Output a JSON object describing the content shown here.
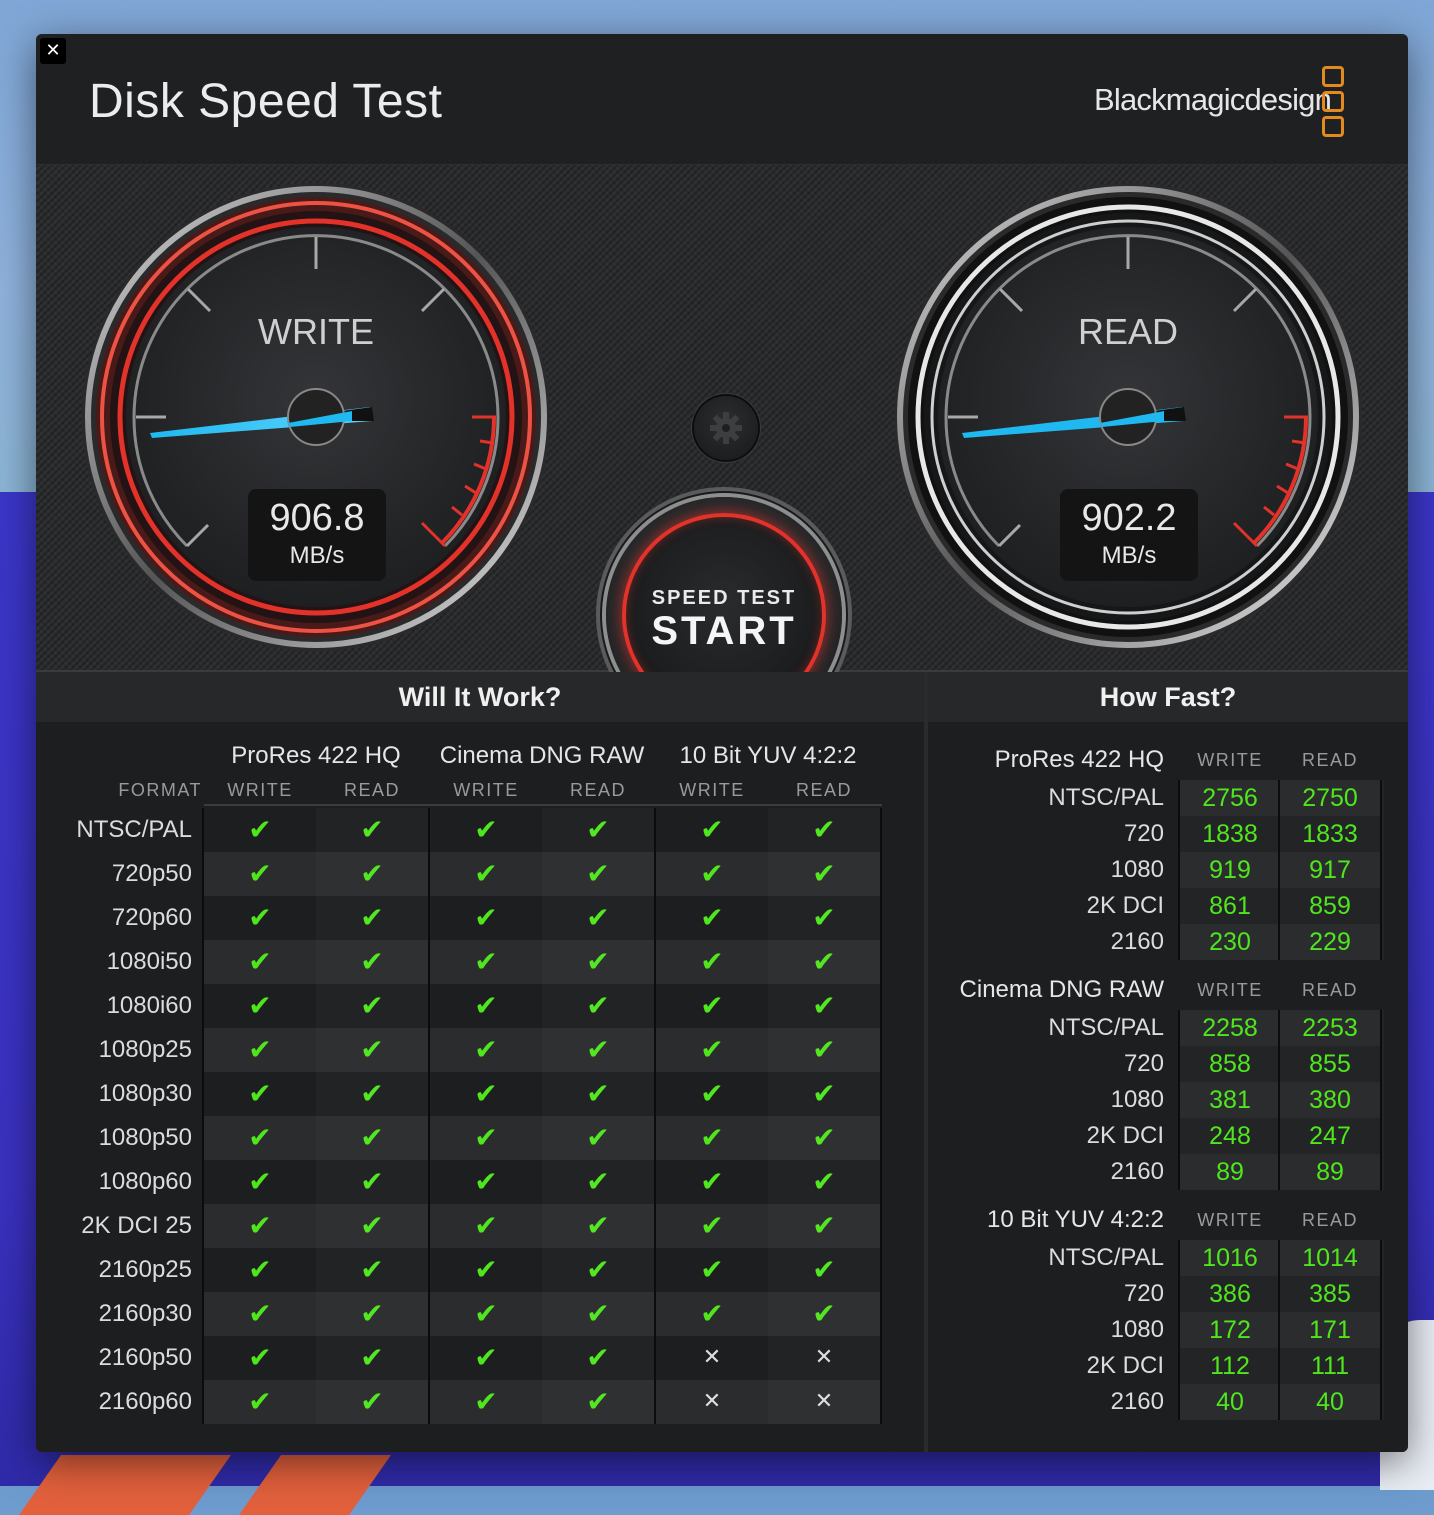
{
  "window": {
    "title": "Disk Speed Test",
    "brand": "Blackmagicdesign",
    "close_label": "✕"
  },
  "gauges": {
    "write": {
      "label": "WRITE",
      "value": "906.8",
      "unit": "MB/s",
      "accent": "#e2322a"
    },
    "read": {
      "label": "READ",
      "value": "902.2",
      "unit": "MB/s",
      "accent": "#e8e8e8"
    }
  },
  "controls": {
    "settings_icon": "gear-icon",
    "start_top": "SPEED TEST",
    "start_main": "START"
  },
  "will_it_work": {
    "title": "Will It Work?",
    "format_header": "FORMAT",
    "groups": [
      {
        "name": "ProRes 422 HQ",
        "write": "WRITE",
        "read": "READ"
      },
      {
        "name": "Cinema DNG RAW",
        "write": "WRITE",
        "read": "READ"
      },
      {
        "name": "10 Bit YUV 4:2:2",
        "write": "WRITE",
        "read": "READ"
      }
    ],
    "rows": [
      {
        "format": "NTSC/PAL",
        "cells": [
          1,
          1,
          1,
          1,
          1,
          1
        ]
      },
      {
        "format": "720p50",
        "cells": [
          1,
          1,
          1,
          1,
          1,
          1
        ]
      },
      {
        "format": "720p60",
        "cells": [
          1,
          1,
          1,
          1,
          1,
          1
        ]
      },
      {
        "format": "1080i50",
        "cells": [
          1,
          1,
          1,
          1,
          1,
          1
        ]
      },
      {
        "format": "1080i60",
        "cells": [
          1,
          1,
          1,
          1,
          1,
          1
        ]
      },
      {
        "format": "1080p25",
        "cells": [
          1,
          1,
          1,
          1,
          1,
          1
        ]
      },
      {
        "format": "1080p30",
        "cells": [
          1,
          1,
          1,
          1,
          1,
          1
        ]
      },
      {
        "format": "1080p50",
        "cells": [
          1,
          1,
          1,
          1,
          1,
          1
        ]
      },
      {
        "format": "1080p60",
        "cells": [
          1,
          1,
          1,
          1,
          1,
          1
        ]
      },
      {
        "format": "2K DCI 25",
        "cells": [
          1,
          1,
          1,
          1,
          1,
          1
        ]
      },
      {
        "format": "2160p25",
        "cells": [
          1,
          1,
          1,
          1,
          1,
          1
        ]
      },
      {
        "format": "2160p30",
        "cells": [
          1,
          1,
          1,
          1,
          1,
          1
        ]
      },
      {
        "format": "2160p50",
        "cells": [
          1,
          1,
          1,
          1,
          0,
          0
        ]
      },
      {
        "format": "2160p60",
        "cells": [
          1,
          1,
          1,
          1,
          0,
          0
        ]
      }
    ],
    "check_glyph": "✔",
    "cross_glyph": "✕"
  },
  "how_fast": {
    "title": "How Fast?",
    "write_header": "WRITE",
    "read_header": "READ",
    "groups": [
      {
        "name": "ProRes 422 HQ",
        "rows": [
          {
            "label": "NTSC/PAL",
            "write": "2756",
            "read": "2750"
          },
          {
            "label": "720",
            "write": "1838",
            "read": "1833"
          },
          {
            "label": "1080",
            "write": "919",
            "read": "917"
          },
          {
            "label": "2K DCI",
            "write": "861",
            "read": "859"
          },
          {
            "label": "2160",
            "write": "230",
            "read": "229"
          }
        ]
      },
      {
        "name": "Cinema DNG RAW",
        "rows": [
          {
            "label": "NTSC/PAL",
            "write": "2258",
            "read": "2253"
          },
          {
            "label": "720",
            "write": "858",
            "read": "855"
          },
          {
            "label": "1080",
            "write": "381",
            "read": "380"
          },
          {
            "label": "2K DCI",
            "write": "248",
            "read": "247"
          },
          {
            "label": "2160",
            "write": "89",
            "read": "89"
          }
        ]
      },
      {
        "name": "10 Bit YUV 4:2:2",
        "rows": [
          {
            "label": "NTSC/PAL",
            "write": "1016",
            "read": "1014"
          },
          {
            "label": "720",
            "write": "386",
            "read": "385"
          },
          {
            "label": "1080",
            "write": "172",
            "read": "171"
          },
          {
            "label": "2K DCI",
            "write": "112",
            "read": "111"
          },
          {
            "label": "2160",
            "write": "40",
            "read": "40"
          }
        ]
      }
    ]
  },
  "colors": {
    "pass": "#4fe61d",
    "needle": "#1fb8f0",
    "redline": "#e2322a",
    "brand_orange": "#e38a1f"
  }
}
